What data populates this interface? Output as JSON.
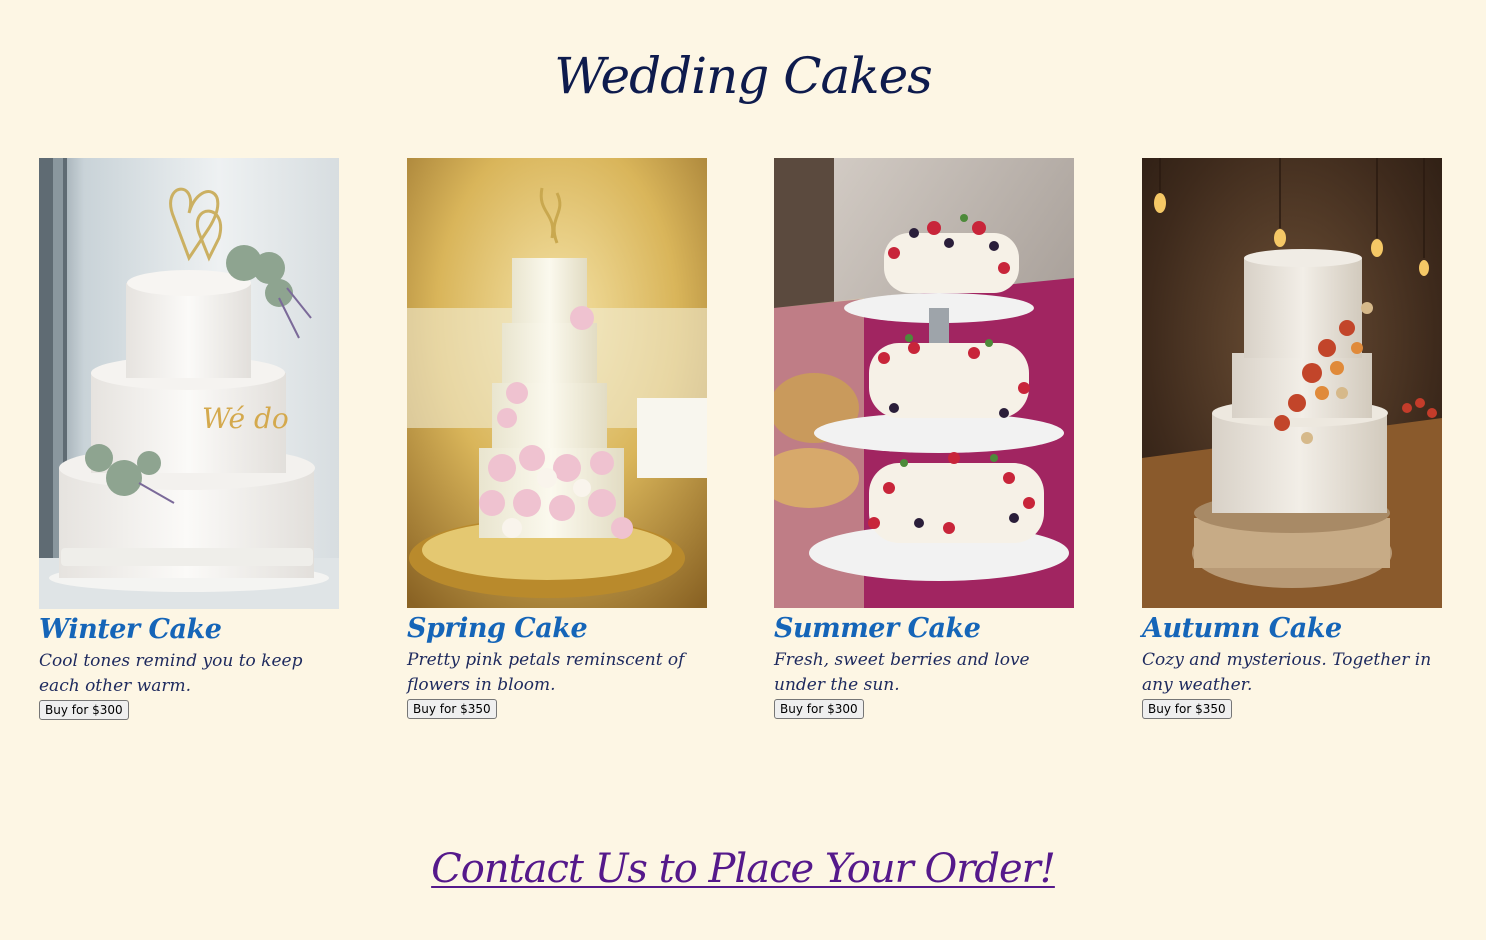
{
  "page": {
    "title": "Wedding Cakes",
    "contact_link": "Contact Us to Place Your Order!"
  },
  "cakes": [
    {
      "name": "Winter Cake",
      "description": "Cool tones remind you to keep each other warm.",
      "button_label": "Buy for $300",
      "image": "white-three-tier-cake-with-succulents-and-heart-topper"
    },
    {
      "name": "Spring Cake",
      "description": "Pretty pink petals reminscent of flowers in bloom.",
      "button_label": "Buy for $350",
      "image": "tall-cream-cake-with-pink-roses-on-gold-stand"
    },
    {
      "name": "Summer Cake",
      "description": "Fresh, sweet berries and love under the sun.",
      "button_label": "Buy for $300",
      "image": "three-tier-white-cake-with-berries-on-stand"
    },
    {
      "name": "Autumn Cake",
      "description": "Cozy and mysterious. Together in any weather.",
      "button_label": "Buy for $350",
      "image": "rustic-white-cake-with-dried-flowers-on-wood-slice"
    }
  ],
  "colors": {
    "background": "#fdf6e4",
    "title": "#0e1b4d",
    "cake_name": "#1565b8",
    "description": "#1e2a5e",
    "contact_link": "#55198b"
  }
}
